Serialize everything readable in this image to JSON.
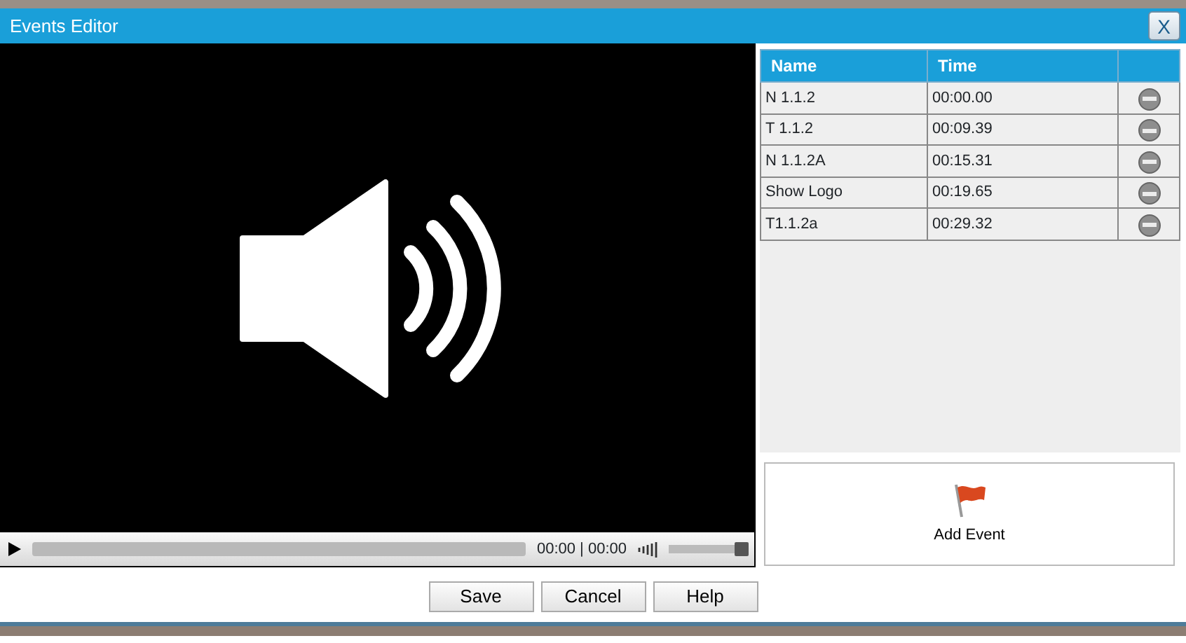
{
  "window": {
    "title": "Events Editor",
    "close_label": "X"
  },
  "player": {
    "time": "00:00 | 00:00",
    "volume": {
      "level": 1
    }
  },
  "table": {
    "columns": [
      "Name",
      "Time"
    ],
    "rows": [
      {
        "name": "N 1.1.2",
        "time": "00:00.00"
      },
      {
        "name": "T 1.1.2",
        "time": "00:09.39"
      },
      {
        "name": "N 1.1.2A",
        "time": "00:15.31"
      },
      {
        "name": "Show Logo",
        "time": "00:19.65"
      },
      {
        "name": "T1.1.2a",
        "time": "00:29.32"
      }
    ]
  },
  "add_event": {
    "label": "Add Event"
  },
  "buttons": [
    "Save",
    "Cancel",
    "Help"
  ]
}
